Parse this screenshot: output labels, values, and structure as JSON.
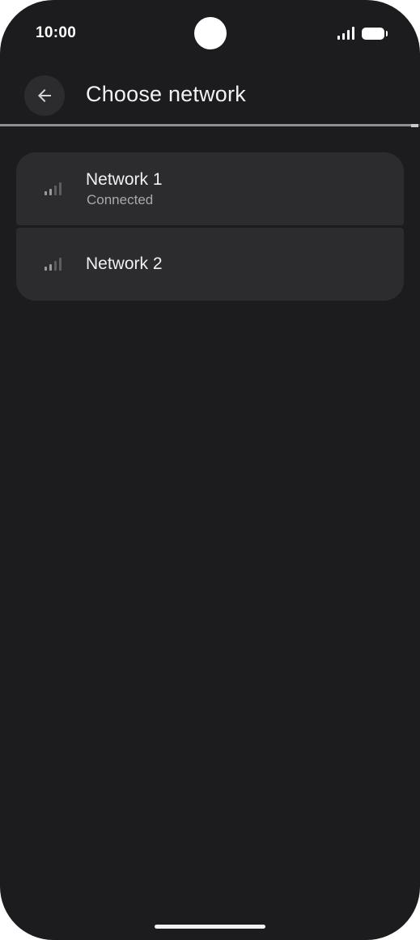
{
  "status_bar": {
    "time": "10:00",
    "signal_icon": "cell-signal-icon",
    "battery_icon": "battery-icon"
  },
  "app_bar": {
    "back_icon": "arrow-back-icon",
    "title": "Choose network"
  },
  "progress": {
    "fraction": 0.98
  },
  "networks": [
    {
      "name": "Network 1",
      "status": "Connected",
      "icon": "signal-strength-icon"
    },
    {
      "name": "Network 2",
      "icon": "signal-strength-icon"
    }
  ],
  "colors": {
    "background": "#1c1c1e",
    "card": "#2c2c2f",
    "text_primary": "#f0f0f0",
    "text_secondary": "#a8a8ae"
  }
}
